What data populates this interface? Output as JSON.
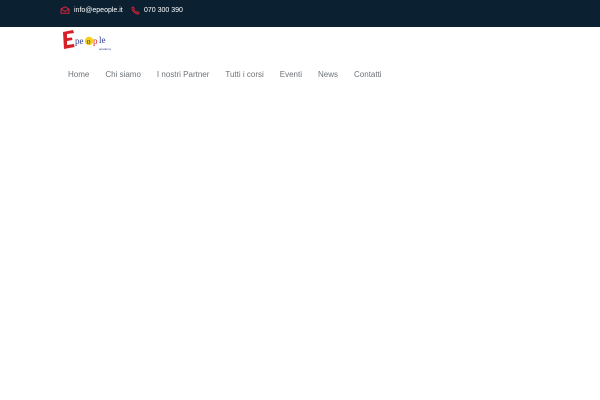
{
  "topbar": {
    "email": "info@epeople.it",
    "phone": "070 300 390",
    "email_icon": "envelope-icon",
    "phone_icon": "phone-icon"
  },
  "logo": {
    "text": "epeople",
    "subtext": "academy"
  },
  "nav": {
    "items": [
      {
        "label": "Home"
      },
      {
        "label": "Chi siamo"
      },
      {
        "label": "I nostri Partner"
      },
      {
        "label": "Tutti i corsi"
      },
      {
        "label": "Eventi"
      },
      {
        "label": "News"
      },
      {
        "label": "Contatti"
      }
    ]
  },
  "colors": {
    "topbar_bg": "#0b2131",
    "icon_accent": "#d6233a",
    "nav_text": "#6e7378",
    "logo_red": "#d61f26",
    "logo_blue": "#2b3990",
    "logo_yellow": "#f7d117"
  }
}
